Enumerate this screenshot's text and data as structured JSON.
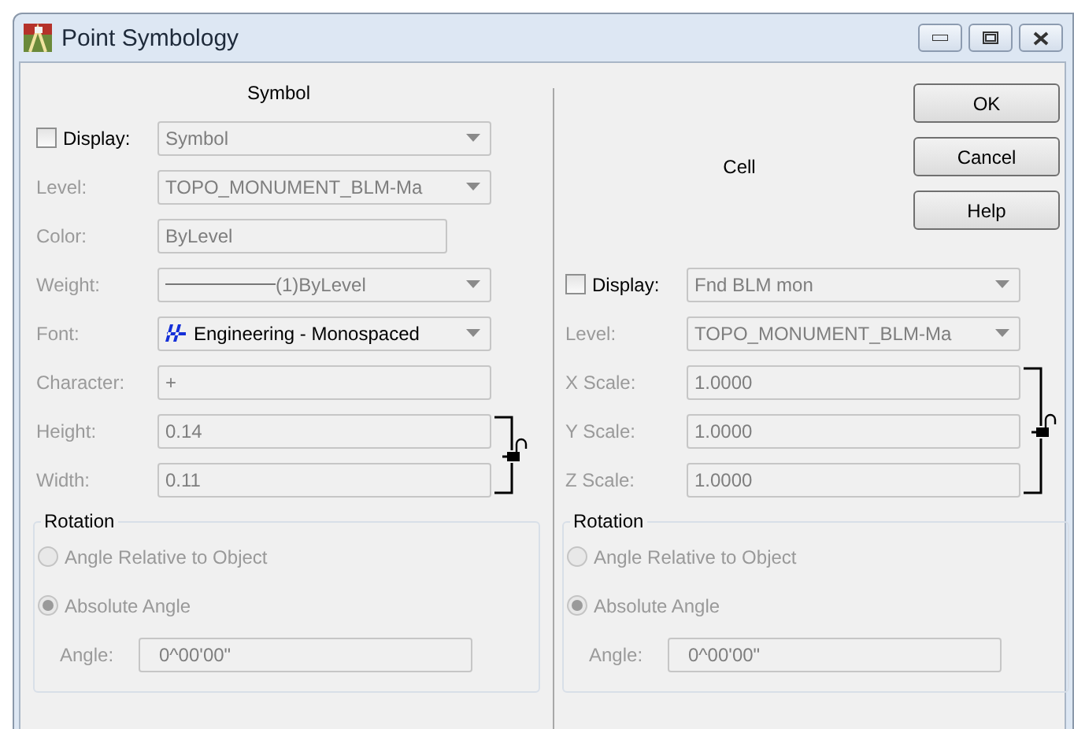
{
  "window": {
    "title": "Point Symbology"
  },
  "symbol": {
    "heading": "Symbol",
    "display": {
      "label": "Display:",
      "checked": false,
      "value": "Symbol"
    },
    "fields": [
      {
        "label": "Level:",
        "value": "TOPO_MONUMENT_BLM-Ma",
        "kind": "dropdown",
        "linked": false
      },
      {
        "label": "Color:",
        "value": "ByLevel",
        "kind": "short",
        "linked": false
      },
      {
        "label": "Weight:",
        "value": "(1)ByLevel",
        "kind": "weight",
        "linked": false
      },
      {
        "label": "Font:",
        "value": "Engineering - Monospaced",
        "kind": "font",
        "linked": false
      },
      {
        "label": "Character:",
        "value": "+",
        "kind": "text",
        "linked": false
      },
      {
        "label": "Height:",
        "value": "0.14",
        "kind": "text",
        "linked": true
      },
      {
        "label": "Width:",
        "value": "0.11",
        "kind": "text",
        "linked": true
      }
    ],
    "rotation": {
      "title": "Rotation",
      "options": [
        {
          "label": "Angle Relative to Object",
          "selected": false
        },
        {
          "label": "Absolute Angle",
          "selected": true
        }
      ],
      "angle_label": "Angle:",
      "angle": "0^00'00\""
    }
  },
  "cell": {
    "heading": "Cell",
    "display": {
      "label": "Display:",
      "checked": false,
      "value": "Fnd BLM mon"
    },
    "fields": [
      {
        "label": "Level:",
        "value": "TOPO_MONUMENT_BLM-Ma",
        "kind": "dropdown",
        "linked": false
      },
      {
        "label": "X Scale:",
        "value": "1.0000",
        "kind": "text",
        "linked": true
      },
      {
        "label": "Y Scale:",
        "value": "1.0000",
        "kind": "text",
        "linked": true
      },
      {
        "label": "Z Scale:",
        "value": "1.0000",
        "kind": "text",
        "linked": true
      }
    ],
    "rotation": {
      "title": "Rotation",
      "options": [
        {
          "label": "Angle Relative to Object",
          "selected": false
        },
        {
          "label": "Absolute Angle",
          "selected": true
        }
      ],
      "angle_label": "Angle:",
      "angle": "0^00'00\""
    }
  },
  "buttons": [
    "OK",
    "Cancel",
    "Help"
  ]
}
